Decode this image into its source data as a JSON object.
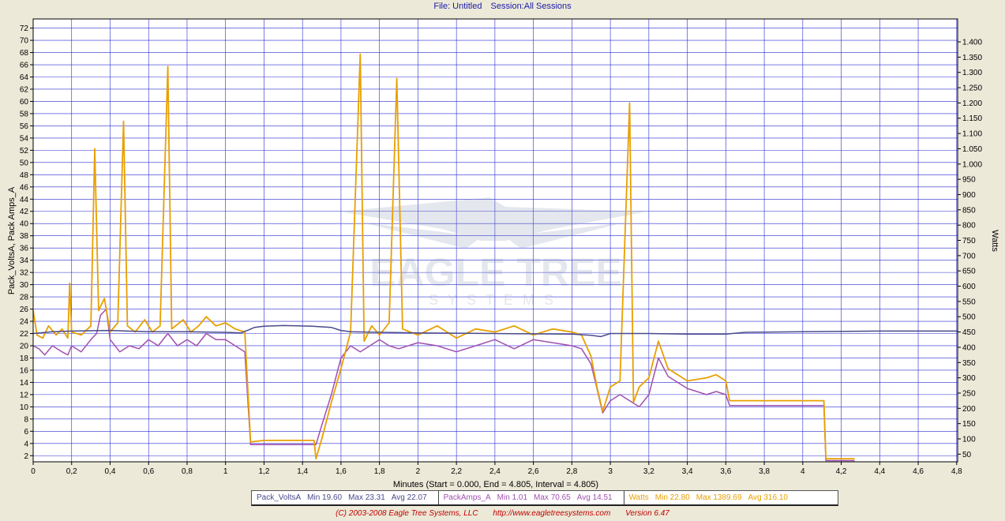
{
  "header": {
    "file_label": "File: Untitled",
    "session_label": "Session:All Sessions"
  },
  "watermark": {
    "line1": "EAGLE TREE",
    "line2": "SYSTEMS"
  },
  "legend": [
    {
      "name": "Pack_VoltsA",
      "min": "Min 19.60",
      "max": "Max 23.31",
      "avg": "Avg 22.07",
      "color": "#4a4a8c"
    },
    {
      "name": "PackAmps_A",
      "min": "Min 1.01",
      "max": "Max 70.65",
      "avg": "Avg 14.51",
      "color": "#a050b0"
    },
    {
      "name": "Watts",
      "min": "Min 22.80",
      "max": "Max 1389.69",
      "avg": "Avg 316.10",
      "color": "#e8a000"
    }
  ],
  "footer": {
    "copyright": "(C) 2003-2008 Eagle Tree Systems, LLC",
    "url": "http://www.eagletreesystems.com",
    "version": "Version 6.47"
  },
  "chart_data": {
    "type": "line",
    "title": "",
    "xlabel": "Minutes (Start = 0.000,  End = 4.805,  Interval = 4.805)",
    "ylabel_left": "Pack_VoltsA, Pack Amps_A",
    "ylabel_right": "Watts",
    "xlim": [
      0,
      4.805
    ],
    "ylim_left": [
      1,
      73.5
    ],
    "ylim_right": [
      25,
      1475
    ],
    "x_ticks": [
      "0",
      "0,2",
      "0,4",
      "0,6",
      "0,8",
      "1",
      "1,2",
      "1,4",
      "1,6",
      "1,8",
      "2",
      "2,2",
      "2,4",
      "2,6",
      "2,8",
      "3",
      "3,2",
      "3,4",
      "3,6",
      "3,8",
      "4",
      "4,2",
      "4,4",
      "4,6",
      "4,8"
    ],
    "y_left_ticks": [
      2,
      4,
      6,
      8,
      10,
      12,
      14,
      16,
      18,
      20,
      22,
      24,
      26,
      28,
      30,
      32,
      34,
      36,
      38,
      40,
      42,
      44,
      46,
      48,
      50,
      52,
      54,
      56,
      58,
      60,
      62,
      64,
      66,
      68,
      70,
      72
    ],
    "y_right_ticks": [
      "50",
      "100",
      "150",
      "200",
      "250",
      "300",
      "350",
      "400",
      "450",
      "500",
      "550",
      "600",
      "650",
      "700",
      "750",
      "800",
      "850",
      "900",
      "950",
      "1.000",
      "1.050",
      "1.100",
      "1.150",
      "1.200",
      "1.250",
      "1.300",
      "1.350",
      "1.400"
    ],
    "grid": true,
    "series": [
      {
        "name": "Pack_VoltsA",
        "axis": "left",
        "color": "#4a4a8c",
        "points": [
          [
            0,
            22.0
          ],
          [
            0.1,
            22.3
          ],
          [
            0.2,
            22.4
          ],
          [
            0.4,
            22.5
          ],
          [
            0.6,
            22.3
          ],
          [
            0.8,
            22.3
          ],
          [
            1.0,
            22.2
          ],
          [
            1.08,
            22.1
          ],
          [
            1.12,
            22.6
          ],
          [
            1.15,
            23.0
          ],
          [
            1.2,
            23.2
          ],
          [
            1.3,
            23.3
          ],
          [
            1.45,
            23.2
          ],
          [
            1.55,
            23.0
          ],
          [
            1.6,
            22.5
          ],
          [
            1.65,
            22.3
          ],
          [
            1.8,
            22.2
          ],
          [
            2.0,
            22.1
          ],
          [
            2.4,
            22.0
          ],
          [
            2.8,
            21.9
          ],
          [
            2.9,
            21.7
          ],
          [
            2.95,
            21.5
          ],
          [
            3.0,
            22.0
          ],
          [
            3.2,
            22.0
          ],
          [
            3.4,
            21.9
          ],
          [
            3.6,
            21.9
          ],
          [
            3.7,
            22.2
          ],
          [
            4.0,
            22.3
          ],
          [
            4.4,
            22.4
          ],
          [
            4.805,
            22.4
          ]
        ]
      },
      {
        "name": "PackAmps_A",
        "axis": "left",
        "color": "#a050b0",
        "points": [
          [
            0,
            20
          ],
          [
            0.03,
            19.5
          ],
          [
            0.06,
            18.5
          ],
          [
            0.1,
            20
          ],
          [
            0.15,
            19
          ],
          [
            0.18,
            18.5
          ],
          [
            0.2,
            20
          ],
          [
            0.25,
            19
          ],
          [
            0.3,
            21
          ],
          [
            0.33,
            22
          ],
          [
            0.35,
            25
          ],
          [
            0.38,
            26
          ],
          [
            0.4,
            21
          ],
          [
            0.45,
            19
          ],
          [
            0.5,
            20
          ],
          [
            0.55,
            19.5
          ],
          [
            0.6,
            21
          ],
          [
            0.65,
            20
          ],
          [
            0.7,
            22
          ],
          [
            0.75,
            20
          ],
          [
            0.8,
            21
          ],
          [
            0.85,
            20
          ],
          [
            0.9,
            22
          ],
          [
            0.95,
            21
          ],
          [
            1.0,
            21
          ],
          [
            1.05,
            20
          ],
          [
            1.1,
            19
          ],
          [
            1.13,
            3.8
          ],
          [
            1.2,
            3.8
          ],
          [
            1.3,
            3.8
          ],
          [
            1.4,
            3.8
          ],
          [
            1.47,
            3.8
          ],
          [
            1.5,
            7
          ],
          [
            1.55,
            12
          ],
          [
            1.6,
            18
          ],
          [
            1.65,
            20
          ],
          [
            1.7,
            19
          ],
          [
            1.75,
            20
          ],
          [
            1.8,
            21
          ],
          [
            1.85,
            20
          ],
          [
            1.9,
            19.5
          ],
          [
            2.0,
            20.5
          ],
          [
            2.1,
            20
          ],
          [
            2.2,
            19
          ],
          [
            2.3,
            20
          ],
          [
            2.4,
            21
          ],
          [
            2.5,
            19.5
          ],
          [
            2.6,
            21
          ],
          [
            2.7,
            20.5
          ],
          [
            2.8,
            20
          ],
          [
            2.85,
            19.5
          ],
          [
            2.9,
            17
          ],
          [
            2.93,
            13
          ],
          [
            2.96,
            9
          ],
          [
            3.0,
            11
          ],
          [
            3.05,
            12
          ],
          [
            3.1,
            11
          ],
          [
            3.15,
            10
          ],
          [
            3.2,
            12
          ],
          [
            3.25,
            18
          ],
          [
            3.3,
            15
          ],
          [
            3.4,
            13
          ],
          [
            3.5,
            12
          ],
          [
            3.55,
            12.5
          ],
          [
            3.6,
            12
          ],
          [
            3.62,
            10.2
          ],
          [
            3.7,
            10.2
          ],
          [
            3.8,
            10.2
          ],
          [
            4.0,
            10.2
          ],
          [
            4.11,
            10.2
          ],
          [
            4.12,
            1.2
          ],
          [
            4.27,
            1.2
          ]
        ]
      },
      {
        "name": "Watts",
        "axis": "right",
        "color": "#e8a000",
        "points": [
          [
            0,
            520
          ],
          [
            0.02,
            440
          ],
          [
            0.05,
            430
          ],
          [
            0.08,
            470
          ],
          [
            0.12,
            440
          ],
          [
            0.15,
            460
          ],
          [
            0.18,
            430
          ],
          [
            0.19,
            610
          ],
          [
            0.2,
            450
          ],
          [
            0.25,
            440
          ],
          [
            0.3,
            470
          ],
          [
            0.32,
            1050
          ],
          [
            0.34,
            520
          ],
          [
            0.37,
            560
          ],
          [
            0.4,
            450
          ],
          [
            0.44,
            480
          ],
          [
            0.47,
            1140
          ],
          [
            0.49,
            470
          ],
          [
            0.53,
            450
          ],
          [
            0.58,
            490
          ],
          [
            0.62,
            450
          ],
          [
            0.66,
            470
          ],
          [
            0.7,
            1320
          ],
          [
            0.72,
            460
          ],
          [
            0.78,
            490
          ],
          [
            0.82,
            450
          ],
          [
            0.86,
            470
          ],
          [
            0.9,
            500
          ],
          [
            0.95,
            470
          ],
          [
            1.0,
            480
          ],
          [
            1.05,
            460
          ],
          [
            1.1,
            450
          ],
          [
            1.13,
            90
          ],
          [
            1.2,
            95
          ],
          [
            1.3,
            95
          ],
          [
            1.46,
            95
          ],
          [
            1.47,
            35
          ],
          [
            1.5,
            100
          ],
          [
            1.55,
            220
          ],
          [
            1.6,
            330
          ],
          [
            1.65,
            450
          ],
          [
            1.7,
            1360
          ],
          [
            1.72,
            420
          ],
          [
            1.76,
            470
          ],
          [
            1.8,
            440
          ],
          [
            1.85,
            480
          ],
          [
            1.89,
            1280
          ],
          [
            1.92,
            460
          ],
          [
            2.0,
            440
          ],
          [
            2.1,
            470
          ],
          [
            2.2,
            430
          ],
          [
            2.3,
            460
          ],
          [
            2.4,
            450
          ],
          [
            2.5,
            470
          ],
          [
            2.6,
            440
          ],
          [
            2.7,
            460
          ],
          [
            2.8,
            450
          ],
          [
            2.85,
            440
          ],
          [
            2.9,
            370
          ],
          [
            2.93,
            270
          ],
          [
            2.96,
            190
          ],
          [
            3.0,
            270
          ],
          [
            3.05,
            290
          ],
          [
            3.1,
            1200
          ],
          [
            3.12,
            220
          ],
          [
            3.15,
            270
          ],
          [
            3.2,
            300
          ],
          [
            3.25,
            420
          ],
          [
            3.3,
            330
          ],
          [
            3.4,
            290
          ],
          [
            3.5,
            300
          ],
          [
            3.55,
            310
          ],
          [
            3.6,
            290
          ],
          [
            3.62,
            225
          ],
          [
            3.7,
            225
          ],
          [
            3.8,
            225
          ],
          [
            4.0,
            225
          ],
          [
            4.11,
            225
          ],
          [
            4.12,
            35
          ],
          [
            4.27,
            35
          ]
        ]
      }
    ]
  }
}
